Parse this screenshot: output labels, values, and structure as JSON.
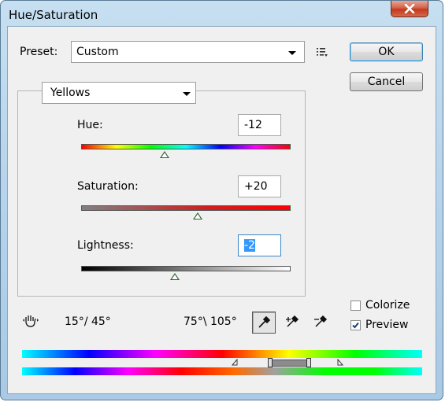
{
  "window": {
    "title": "Hue/Saturation"
  },
  "preset": {
    "label": "Preset:",
    "value": "Custom"
  },
  "buttons": {
    "ok": "OK",
    "cancel": "Cancel"
  },
  "edit_channel": {
    "value": "Yellows"
  },
  "hue": {
    "label": "Hue:",
    "value": "-12"
  },
  "saturation": {
    "label": "Saturation:",
    "value": "+20"
  },
  "lightness": {
    "label": "Lightness:",
    "value": "-2"
  },
  "range": {
    "left": "15°/ 45°",
    "right": "75°\\ 105°"
  },
  "colorize": {
    "label": "Colorize",
    "checked": false
  },
  "preview": {
    "label": "Preview",
    "checked": true
  },
  "icons": [
    "close-icon",
    "preset-options-icon",
    "hand-adjust-icon",
    "eyedropper-icon",
    "eyedropper-plus-icon",
    "eyedropper-minus-icon"
  ]
}
